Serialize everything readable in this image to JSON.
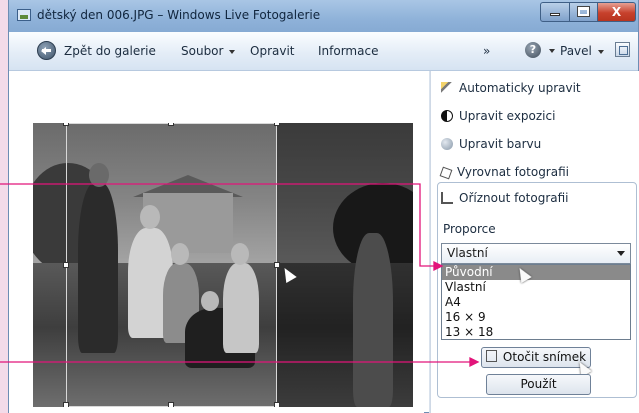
{
  "window": {
    "title": "dětský den 006.JPG – Windows Live Fotogalerie",
    "min_label": "",
    "max_label": "",
    "close_label": "X"
  },
  "toolbar": {
    "back_label": "Zpět do galerie",
    "file_label": "Soubor",
    "fix_label": "Opravit",
    "info_label": "Informace",
    "more_label": "»",
    "help_label": "?",
    "user_label": "Pavel"
  },
  "panel": {
    "actions": [
      {
        "label": "Automaticky upravit",
        "icon": "magic-wand-icon"
      },
      {
        "label": "Upravit expozici",
        "icon": "exposure-icon"
      },
      {
        "label": "Upravit barvu",
        "icon": "color-icon"
      },
      {
        "label": "Vyrovnat fotografii",
        "icon": "straighten-icon"
      },
      {
        "label": "Oříznout fotografii",
        "icon": "crop-icon"
      }
    ],
    "proportion_label": "Proporce",
    "proportion_value": "Vlastní",
    "options": [
      "Původní",
      "Vlastní",
      "A4",
      "16 × 9",
      "13 × 18"
    ],
    "highlighted_option": "Původní",
    "rotate_button": "Otočit snímek",
    "apply_button": "Použít"
  },
  "colors": {
    "callout": "#e2147a",
    "page_background": "#f3dbe9"
  }
}
